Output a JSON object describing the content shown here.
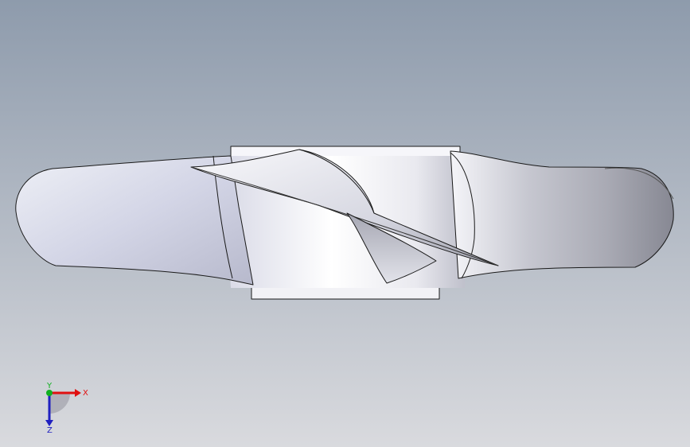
{
  "viewport": {
    "background_top": "#8e9bac",
    "background_bottom": "#d9dade"
  },
  "model": {
    "name": "propeller",
    "blade_light": "#f4f4f8",
    "blade_mid": "#c9cbd9",
    "blade_dark": "#8d8f9e",
    "edge_color": "#1a1a1a"
  },
  "triad": {
    "x_label": "X",
    "y_label": "Y",
    "z_label": "Z",
    "x_color": "#e01010",
    "y_color": "#10b020",
    "z_color": "#2020c0"
  }
}
